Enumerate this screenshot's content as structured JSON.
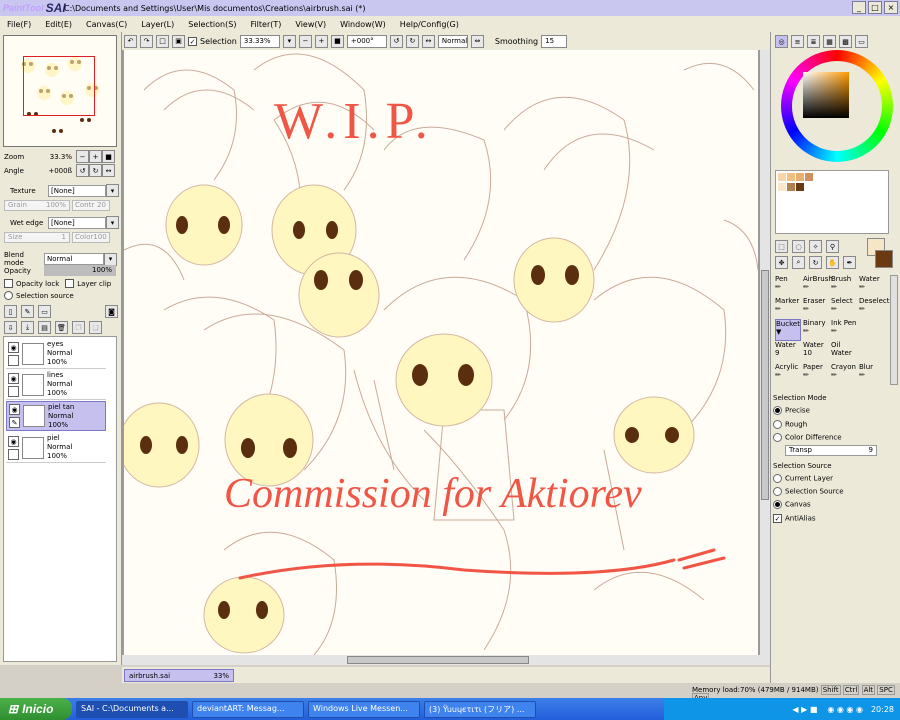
{
  "app": {
    "logo_prefix": "PaintTool",
    "logo_main": "SAI",
    "title": "C:\\Documents and Settings\\User\\Mis documentos\\Creations\\airbrush.sai (*)"
  },
  "menu": [
    "File(F)",
    "Edit(E)",
    "Canvas(C)",
    "Layer(L)",
    "Selection(S)",
    "Filter(T)",
    "View(V)",
    "Window(W)",
    "Help/Config(G)"
  ],
  "toolbar": {
    "selection_label": "Selection",
    "zoom_value": "33.33%",
    "angle_value": "+000°",
    "mode_value": "Normal",
    "smoothing_label": "Smoothing",
    "smoothing_value": "15"
  },
  "navigator": {
    "zoom_label": "Zoom",
    "zoom_value": "33.3%",
    "angle_label": "Angle",
    "angle_value": "+000ß"
  },
  "brush_settings": {
    "texture_label": "Texture",
    "texture_value": "[None]",
    "grain_label": "Grain",
    "grain_value": "100%",
    "contrast_label": "Contr",
    "contrast_value": "20",
    "wet_edge_label": "Wet edge",
    "wet_edge_value": "[None]",
    "size_label": "Size",
    "size_value": "1",
    "color_label": "Color",
    "color_value": "100"
  },
  "layer_props": {
    "blend_label": "Blend mode",
    "blend_value": "Normal",
    "opacity_label": "Opacity",
    "opacity_value": "100%",
    "opacity_lock": "Opacity lock",
    "layer_clip": "Layer clip",
    "selection_source": "Selection source"
  },
  "layers": [
    {
      "name": "eyes",
      "mode": "Normal",
      "opacity": "100%",
      "selected": false
    },
    {
      "name": "lines",
      "mode": "Normal",
      "opacity": "100%",
      "selected": false
    },
    {
      "name": "piel tan",
      "mode": "Normal",
      "opacity": "100%",
      "selected": true
    },
    {
      "name": "piel",
      "mode": "Normal",
      "opacity": "100%",
      "selected": false
    }
  ],
  "canvas_text": {
    "wip": "W.I.P.",
    "commission": "Commission for Aktiorev"
  },
  "document_tab": {
    "name": "airbrush.sai",
    "zoom": "33%"
  },
  "tools": [
    [
      "Pen",
      "AirBrush",
      "Brush",
      "Water"
    ],
    [
      "Marker",
      "Eraser",
      "Select",
      "Deselect"
    ],
    [
      "Bucket",
      "Binary",
      "Ink Pen",
      ""
    ],
    [
      "Water 9",
      "Water 10",
      "Oil Water",
      ""
    ],
    [
      "Acrylic",
      "Paper",
      "Crayon",
      "Blur"
    ]
  ],
  "selection_panel": {
    "mode_title": "Selection Mode",
    "mode_options": [
      "Precise",
      "Rough",
      "Color Difference"
    ],
    "mode_selected": "Precise",
    "transp_label": "Transp",
    "transp_value": "9",
    "source_title": "Selection Source",
    "source_options": [
      "Current Layer",
      "Selection Source",
      "Canvas"
    ],
    "source_selected": "Canvas",
    "antialias": "AntiAlias"
  },
  "status": {
    "memory": "Memory load:70% (479MB / 914MB)",
    "toggles": [
      "Shift",
      "Ctrl",
      "Alt",
      "SPC",
      "Any"
    ]
  },
  "taskbar": {
    "start": "Inicio",
    "tasks": [
      "SAI - C:\\Documents a...",
      "deviantART: Messag...",
      "Windows Live Messen...",
      "(3) Ÿuuɥєτιτι (フリア) ..."
    ],
    "clock": "20:28"
  },
  "colors": {
    "accent": "#c6c0ef",
    "wip_text": "#f05545",
    "primary_color": "#f5e6c8",
    "secondary_color": "#6b3a12"
  }
}
